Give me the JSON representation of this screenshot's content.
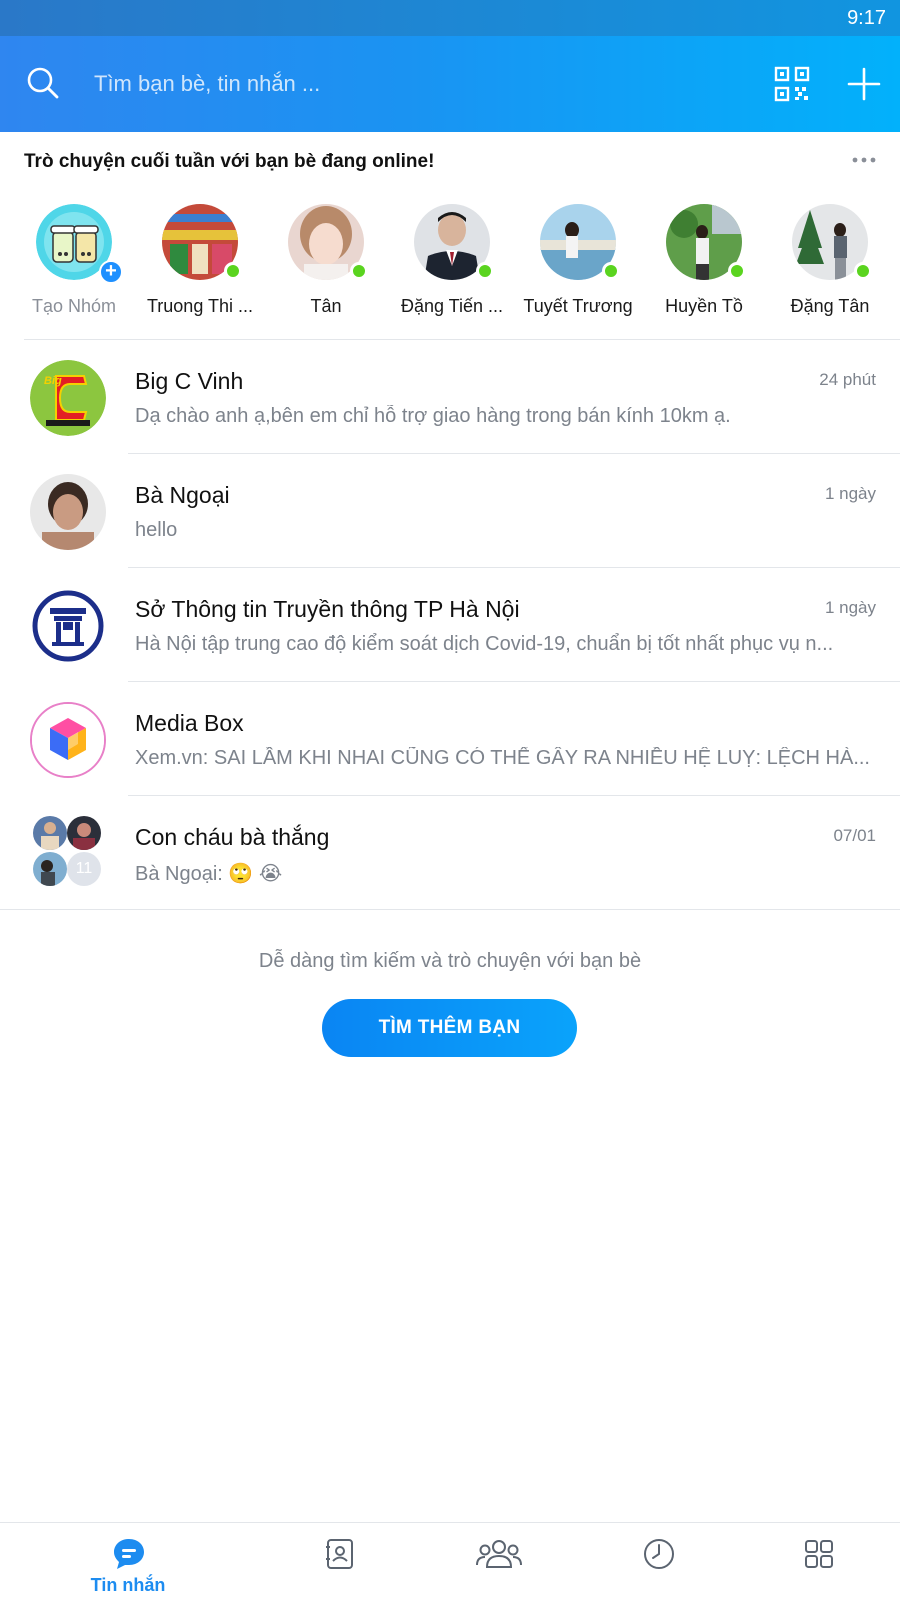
{
  "status_bar": {
    "time": "9:17"
  },
  "header": {
    "search_placeholder": "Tìm bạn bè, tin nhắn ...",
    "icons": [
      "search-icon",
      "qr-code-icon",
      "plus-icon"
    ]
  },
  "online": {
    "title": "Trò chuyện cuối tuần với bạn bè đang online!",
    "items": [
      {
        "name": "Tạo Nhóm",
        "type": "create"
      },
      {
        "name": "Truong Thi ...",
        "online": true
      },
      {
        "name": "Tân",
        "online": true
      },
      {
        "name": "Đặng Tiến ...",
        "online": true
      },
      {
        "name": "Tuyết Trương",
        "online": true
      },
      {
        "name": "Huyền Tồ",
        "online": true
      },
      {
        "name": "Đặng Tân",
        "online": true
      }
    ]
  },
  "conversations": [
    {
      "name": "Big C Vinh",
      "message": "Dạ chào anh ạ,bên em chỉ hỗ trợ giao hàng trong bán kính 10km ạ.",
      "time": "24 phút"
    },
    {
      "name": "Bà Ngoại",
      "message": "hello",
      "time": "1 ngày"
    },
    {
      "name": "Sở Thông tin Truyền thông TP Hà Nội",
      "message": "Hà Nội tập trung cao độ kiểm soát dịch Covid-19, chuẩn bị tốt nhất phục vụ n...",
      "time": "1 ngày"
    },
    {
      "name": "Media Box",
      "message": "Xem.vn: SAI LẦM KHI NHAI CŨNG CÓ THỂ GÂY RA NHIỀU HỆ LUỴ: LỆCH HÀ...",
      "time": ""
    },
    {
      "name": "Con cháu bà thắng",
      "message": "Bà Ngoại: 🙄 😭",
      "time": "07/01",
      "member_count": "11"
    }
  ],
  "find_friends": {
    "hint": "Dễ dàng tìm kiếm và trò chuyện với bạn bè",
    "button": "TÌM THÊM BẠN"
  },
  "bottom_nav": {
    "active_label": "Tin nhắn",
    "items": [
      "messages-icon",
      "contacts-icon",
      "groups-icon",
      "timeline-icon",
      "more-apps-icon"
    ],
    "accent": "#1d8cf0"
  }
}
